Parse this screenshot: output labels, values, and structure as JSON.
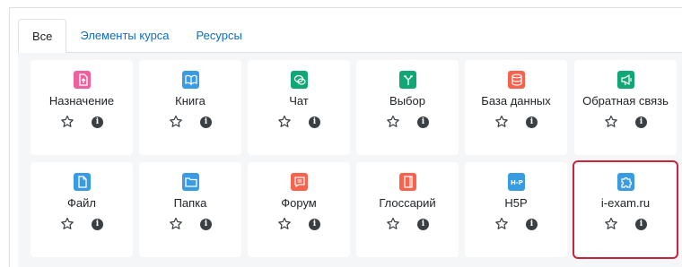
{
  "tabs": [
    {
      "label": "Все",
      "active": true
    },
    {
      "label": "Элементы курса",
      "active": false
    },
    {
      "label": "Ресурсы",
      "active": false
    }
  ],
  "modules": [
    {
      "label": "Назначение",
      "icon": "assignment-icon",
      "color": "#f0609f"
    },
    {
      "label": "Книга",
      "icon": "book-icon",
      "color": "#399be2"
    },
    {
      "label": "Чат",
      "icon": "chat-icon",
      "color": "#11a676"
    },
    {
      "label": "Выбор",
      "icon": "choice-icon",
      "color": "#11a676"
    },
    {
      "label": "База данных",
      "icon": "database-icon",
      "color": "#f7634d"
    },
    {
      "label": "Обратная связь",
      "icon": "feedback-icon",
      "color": "#11a676"
    },
    {
      "label": "Файл",
      "icon": "file-icon",
      "color": "#399be2"
    },
    {
      "label": "Папка",
      "icon": "folder-icon",
      "color": "#399be2"
    },
    {
      "label": "Форум",
      "icon": "forum-icon",
      "color": "#f7634d"
    },
    {
      "label": "Глоссарий",
      "icon": "glossary-icon",
      "color": "#f7634d"
    },
    {
      "label": "H5P",
      "icon": "h5p-icon",
      "color": "#399be2"
    },
    {
      "label": "i-exam.ru",
      "icon": "puzzle-icon",
      "color": "#399be2",
      "highlighted": true
    }
  ],
  "colors": {
    "link": "#0f6cbf",
    "grid_background": "#f5f6f7",
    "highlight_border": "#c9243c",
    "info_icon": "#3a3f44"
  }
}
